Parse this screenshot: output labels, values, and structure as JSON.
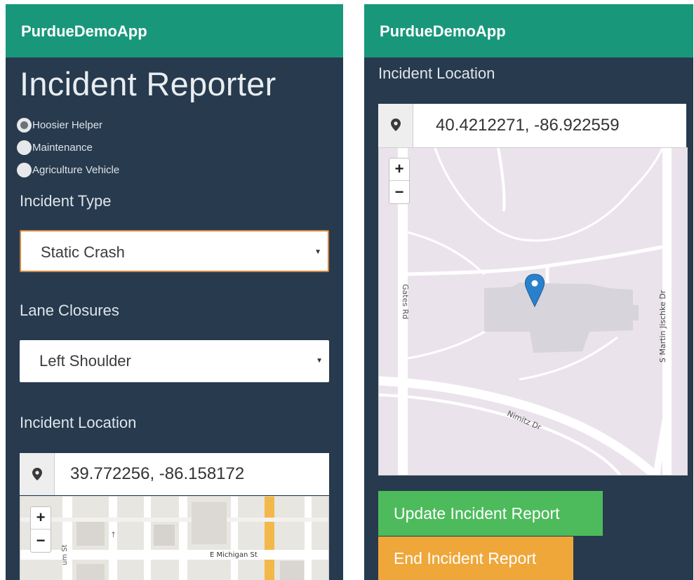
{
  "left_screen": {
    "app_title": "PurdueDemoApp",
    "page_heading": "Incident Reporter",
    "radio_options": [
      {
        "label": "Hoosier Helper",
        "checked": true
      },
      {
        "label": "Maintenance",
        "checked": false
      },
      {
        "label": "Agriculture Vehicle",
        "checked": false
      }
    ],
    "incident_type": {
      "label": "Incident Type",
      "selected": "Static Crash"
    },
    "lane_closures": {
      "label": "Lane Closures",
      "selected": "Left Shoulder"
    },
    "incident_location": {
      "label": "Incident Location",
      "value": "39.772256, -86.158172"
    },
    "map": {
      "zoom_in": "+",
      "zoom_out": "−",
      "street_labels": [
        "E Michigan St",
        "um St"
      ]
    }
  },
  "right_screen": {
    "app_title": "PurdueDemoApp",
    "incident_location": {
      "label": "Incident Location",
      "value": "40.4212271, -86.922559"
    },
    "map": {
      "zoom_in": "+",
      "zoom_out": "−",
      "street_labels": [
        "Gates Rd",
        "S Martin Jischke Dr",
        "Nimitz Dr"
      ]
    },
    "update_button": "Update Incident Report",
    "end_button": "End Incident Report"
  },
  "colors": {
    "navbar": "#19977a",
    "background": "#273a4e",
    "update_button": "#4dbb5c",
    "end_button": "#efa73a",
    "map_pin": "#2a81cb"
  },
  "icons": {
    "location_addon": "map-marker-icon",
    "map_pin": "map-pin-icon"
  }
}
